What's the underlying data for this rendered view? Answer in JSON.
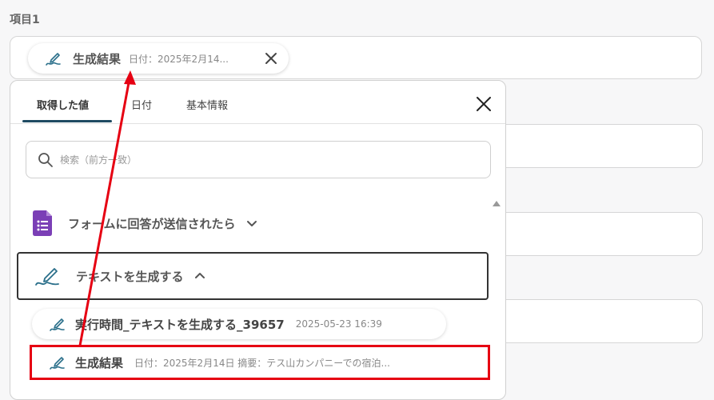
{
  "field": {
    "label": "項目1"
  },
  "chip": {
    "title": "生成結果",
    "subtitle": "日付：2025年2月14..."
  },
  "dropdown": {
    "tabs": [
      {
        "label": "取得した値",
        "active": true
      },
      {
        "label": "日付",
        "active": false
      },
      {
        "label": "基本情報",
        "active": false
      }
    ],
    "search_placeholder": "検索（前方一致）",
    "sections": [
      {
        "title": "フォームに回答が送信されたら",
        "icon": "google-forms-icon",
        "expanded": false
      },
      {
        "title": "テキストを生成する",
        "icon": "pen-icon",
        "expanded": true
      }
    ],
    "items": [
      {
        "title": "実行時間_テキストを生成する_39657",
        "subtitle": "2025-05-23 16:39"
      },
      {
        "title": "生成結果",
        "subtitle": "日付：2025年2月14日 摘要：テス山カンパニーでの宿泊..."
      }
    ]
  },
  "colors": {
    "accent": "#1f4b62",
    "pen_icon": "#2a6f8a",
    "forms_icon": "#7b3fb6",
    "highlight": "#e60012"
  }
}
